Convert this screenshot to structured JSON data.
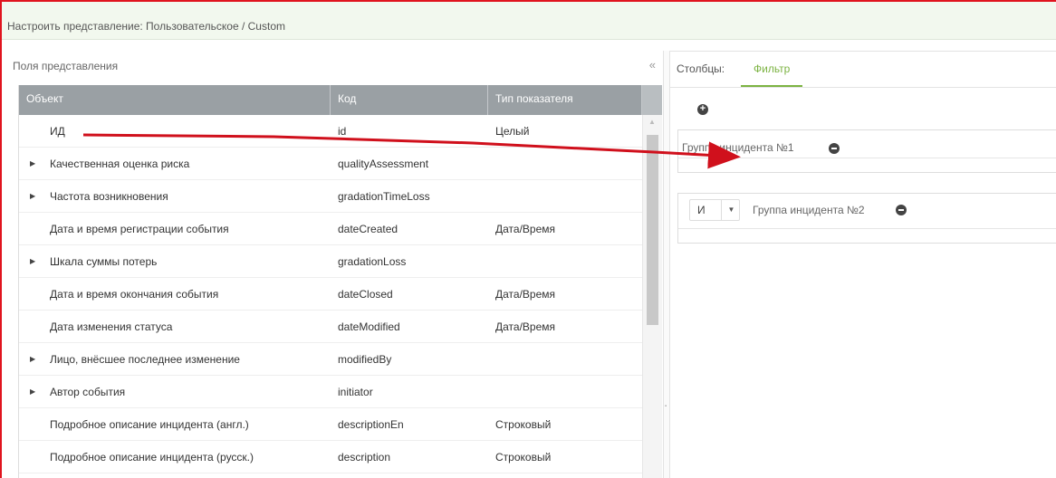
{
  "window": {
    "title": "Настроить представление: Пользовательское / Custom"
  },
  "left_panel": {
    "title": "Поля представления",
    "collapse_icon": "«",
    "columns": [
      "Объект",
      "Код",
      "Тип показателя"
    ],
    "rows": [
      {
        "expandable": false,
        "name": "ИД",
        "code": "id",
        "type": "Целый"
      },
      {
        "expandable": true,
        "name": "Качественная оценка риска",
        "code": "qualityAssessment",
        "type": ""
      },
      {
        "expandable": true,
        "name": "Частота возникновения",
        "code": "gradationTimeLoss",
        "type": ""
      },
      {
        "expandable": false,
        "name": "Дата и время регистрации события",
        "code": "dateCreated",
        "type": "Дата/Время"
      },
      {
        "expandable": true,
        "name": "Шкала суммы потерь",
        "code": "gradationLoss",
        "type": ""
      },
      {
        "expandable": false,
        "name": "Дата и время окончания события",
        "code": "dateClosed",
        "type": "Дата/Время"
      },
      {
        "expandable": false,
        "name": "Дата изменения статуса",
        "code": "dateModified",
        "type": "Дата/Время"
      },
      {
        "expandable": true,
        "name": "Лицо, внёсшее последнее изменение",
        "code": "modifiedBy",
        "type": ""
      },
      {
        "expandable": true,
        "name": "Автор события",
        "code": "initiator",
        "type": ""
      },
      {
        "expandable": false,
        "name": "Подробное описание инцидента (англ.)",
        "code": "descriptionEn",
        "type": "Строковый"
      },
      {
        "expandable": false,
        "name": "Подробное описание инцидента (русск.)",
        "code": "description",
        "type": "Строковый"
      }
    ]
  },
  "right_panel": {
    "tabs": [
      {
        "label": "Столбцы:",
        "active": false
      },
      {
        "label": "Фильтр",
        "active": true
      }
    ],
    "groups": [
      {
        "label": "Группа инцидента №1",
        "operator": ""
      },
      {
        "label": "Группа инцидента №2",
        "operator": "И"
      }
    ]
  },
  "colors": {
    "frame": "#e0141e",
    "accent": "#7cb342",
    "header_bg": "#9aa0a4",
    "arrow": "#d0101c"
  },
  "icons": {
    "expander": "triangle-right-icon",
    "add": "plus-circle-icon",
    "remove": "minus-circle-icon",
    "dropdown": "caret-down-icon"
  }
}
